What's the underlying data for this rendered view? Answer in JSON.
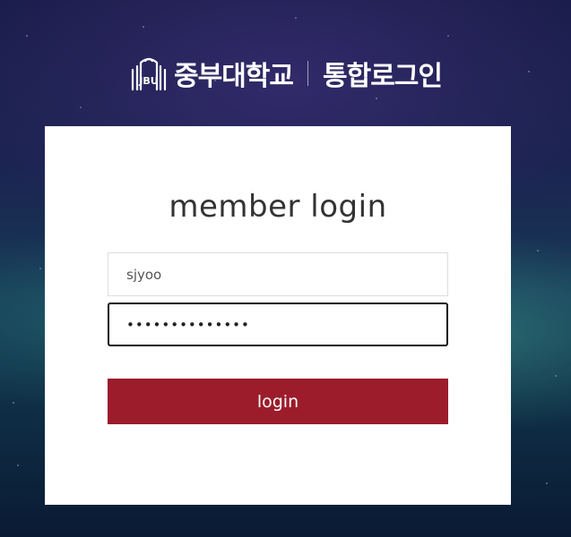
{
  "header": {
    "university_name": "중부대학교",
    "login_title": "통합로그인",
    "emblem_text": "JBU"
  },
  "card": {
    "title": "member login"
  },
  "form": {
    "username_value": "sjyoo",
    "password_value": "••••••••••••••",
    "submit_label": "login"
  },
  "colors": {
    "button": "#9c1c2b",
    "card_background": "#ffffff",
    "text": "#333333"
  }
}
